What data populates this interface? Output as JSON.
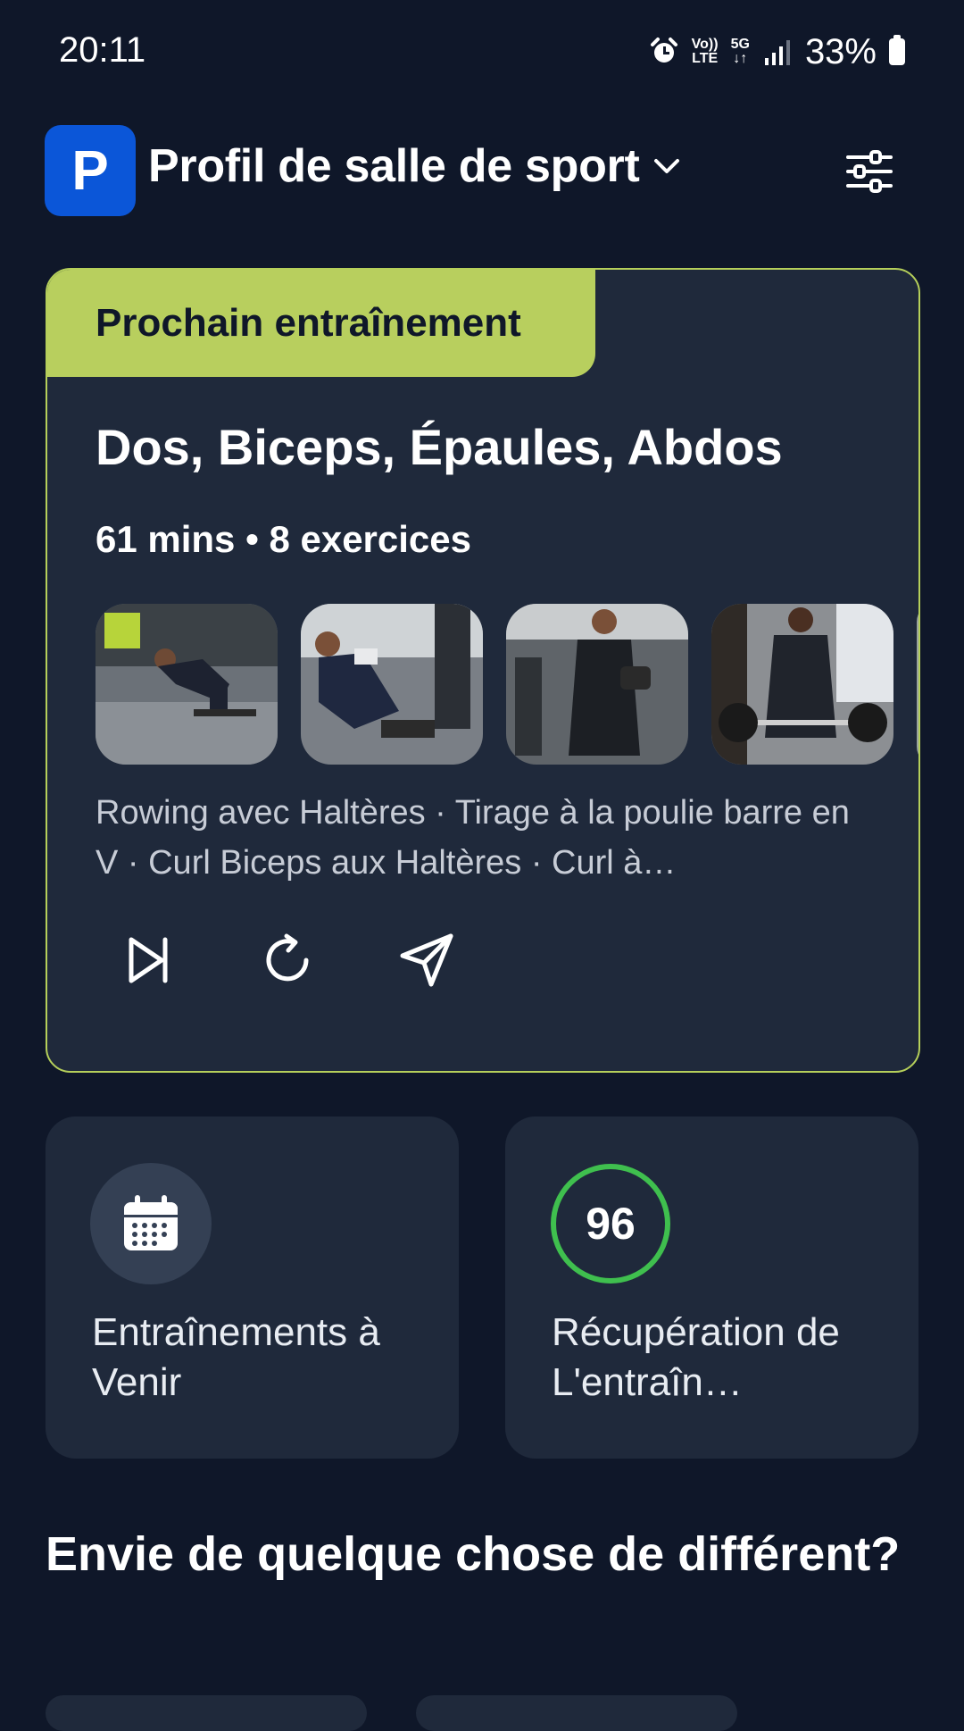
{
  "status_bar": {
    "time": "20:11",
    "network_top": "Vo))",
    "network_bottom": "LTE",
    "gen_top": "5G",
    "gen_bottom": "↓↑",
    "battery": "33%"
  },
  "header": {
    "logo_letter": "P",
    "title": "Profil de salle de sport"
  },
  "next_workout": {
    "badge": "Prochain entraînement",
    "title": "Dos, Biceps, Épaules, Abdos",
    "meta": "61 mins • 8 exercices",
    "exercises_text": "Rowing avec Haltères · Tirage à la poulie barre en V · Curl Biceps aux Haltères · Curl à…",
    "thumbnails": [
      "rowing-thumbnail",
      "cable-row-thumbnail",
      "dumbbell-curl-thumbnail",
      "barbell-curl-thumbnail"
    ]
  },
  "tiles": {
    "upcoming_label": "Entraînements à Venir",
    "recovery_label": "Récupération de L'entraîn…",
    "recovery_score": "96"
  },
  "section": {
    "title": "Envie de quelque chose de différent?"
  },
  "colors": {
    "background": "#0f1729",
    "card": "#1f293b",
    "accent": "#b8cf5e",
    "brand": "#0b56d8",
    "recovery_ring": "#3fbf4e"
  }
}
